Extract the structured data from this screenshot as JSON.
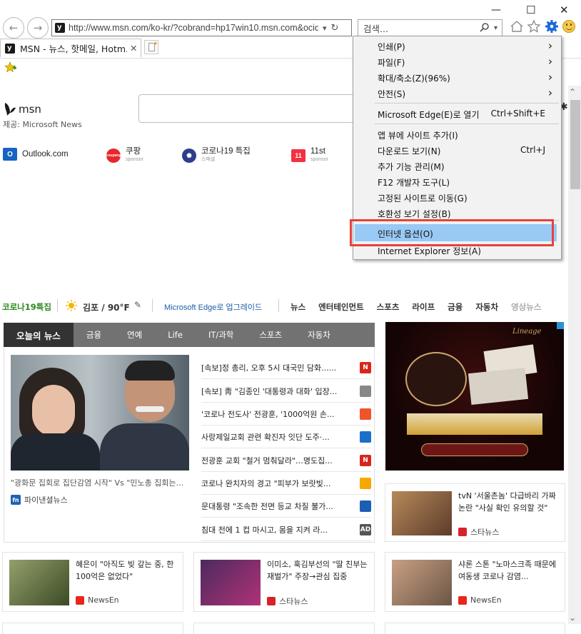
{
  "browser": {
    "address": "http://www.msn.com/ko-kr/?cobrand=hp17win10.msn.com&ocid",
    "search_placeholder": "검색...",
    "tab_title": "MSN - 뉴스, 핫메일, Hotm...",
    "window_controls": {
      "minimize": "—",
      "maximize": "☐",
      "close": "✕"
    }
  },
  "msn": {
    "logo": "msn",
    "provider": "제공: Microsoft News",
    "quicklinks": [
      {
        "label": "Outlook.com",
        "sub": ""
      },
      {
        "label": "쿠팡",
        "sub": "sponsor"
      },
      {
        "label": "코로나19 특집",
        "sub": "스페셜"
      },
      {
        "label": "11st",
        "sub": "sponsor"
      }
    ],
    "covid_link": "코로나19특집",
    "weather": "김포 / 90°F",
    "edge_upgrade": "Microsoft Edge로 업그레이드",
    "topnav": [
      "뉴스",
      "엔터테인먼트",
      "스포츠",
      "라이프",
      "금융",
      "자동차",
      "영상뉴스"
    ],
    "news_tabs": [
      "오늘의 뉴스",
      "금융",
      "연예",
      "Life",
      "IT/과학",
      "스포츠",
      "자동차"
    ],
    "hero_caption": "\"광화문 집회로 집단감염 시작\" Vs \"민노총 집회는...",
    "hero_source": "파이낸셜뉴스",
    "headlines": [
      {
        "text": "[속보]정 총리, 오후 5시 대국민 담화......",
        "badge": "N",
        "color": "#d7261e"
      },
      {
        "text": "[속보] 靑 \"김종인 '대통령과 대화' 입장...",
        "badge": "",
        "color": "#888"
      },
      {
        "text": "'코로나 전도사' 전광훈, '1000억원 손...",
        "badge": "",
        "color": "#f0552a"
      },
      {
        "text": "사랑제일교회 관련 확진자 잇단 도주·...",
        "badge": "",
        "color": "#1b6fc9"
      },
      {
        "text": "전광훈 교회 \"철거 멈춰달라\"…명도집...",
        "badge": "N",
        "color": "#d7261e"
      },
      {
        "text": "코로나 완치자의 경고 \"피부가 보랏빛...",
        "badge": "",
        "color": "#f5a800"
      },
      {
        "text": "문대통령 \"조속한 전면 등교 차질 불가...",
        "badge": "",
        "color": "#1a5fb4"
      },
      {
        "text": "침대 전에 1 컵 마시고, 몸을 지켜 라...",
        "badge": "AD",
        "color": "#555"
      }
    ],
    "ad_card": {
      "caption": "tvN '서울촌놈' 다급바리 가짜 논란 \"사실 확인 유의할 것\"",
      "source": "스타뉴스"
    },
    "bottom_cards": [
      {
        "caption": "혜은이 \"아직도 빚 갚는 중, 한 100억은 없었다\"",
        "source": "NewsEn"
      },
      {
        "caption": "이미소, 훅김부선의 \"딸 친부는 재벌가\" 주장→관심 집중",
        "source": "스타뉴스"
      },
      {
        "caption": "샤론 스톤 \"노마스크족 때문에 여동생 코로나 감염...",
        "source": "NewsEn"
      }
    ]
  },
  "menu": {
    "items": [
      {
        "label": "인쇄(P)",
        "shortcut": "",
        "arrow": true
      },
      {
        "label": "파일(F)",
        "shortcut": "",
        "arrow": true
      },
      {
        "label": "확대/축소(Z)(96%)",
        "shortcut": "",
        "arrow": true
      },
      {
        "label": "안전(S)",
        "shortcut": "",
        "arrow": true
      },
      {
        "label": "Microsoft Edge(E)로 열기",
        "shortcut": "Ctrl+Shift+E",
        "arrow": false
      },
      {
        "label": "앱 뷰에 사이트 추가(I)",
        "shortcut": "",
        "arrow": false
      },
      {
        "label": "다운로드 보기(N)",
        "shortcut": "Ctrl+J",
        "arrow": false
      },
      {
        "label": "추가 기능 관리(M)",
        "shortcut": "",
        "arrow": false
      },
      {
        "label": "F12 개발자 도구(L)",
        "shortcut": "",
        "arrow": false
      },
      {
        "label": "고정된 사이트로 이동(G)",
        "shortcut": "",
        "arrow": false
      },
      {
        "label": "호환성 보기 설정(B)",
        "shortcut": "",
        "arrow": false
      },
      {
        "label": "인터넷 옵션(O)",
        "shortcut": "",
        "arrow": false
      },
      {
        "label": "Internet Explorer 정보(A)",
        "shortcut": "",
        "arrow": false
      }
    ],
    "arrow_glyph": "›"
  },
  "colors": {
    "highlight": "#99c9f5",
    "highlight_border": "#e8413f",
    "gear": "#1e6ad6"
  }
}
